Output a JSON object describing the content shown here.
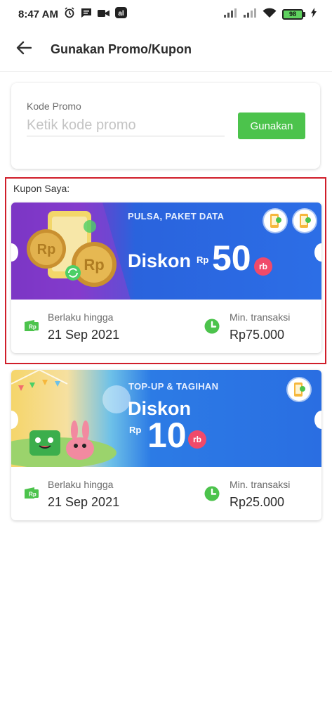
{
  "status_bar": {
    "time": "8:47 AM",
    "battery": "98"
  },
  "app_bar": {
    "title": "Gunakan Promo/Kupon"
  },
  "promo": {
    "label": "Kode Promo",
    "placeholder": "Ketik kode promo",
    "button_label": "Gunakan"
  },
  "coupons_section": {
    "label": "Kupon Saya:"
  },
  "coupons": [
    {
      "tag": "PULSA, PAKET DATA",
      "headline": "Diskon",
      "currency": "Rp",
      "amount": "50",
      "unit": "rb",
      "valid_label": "Berlaku hingga",
      "valid_date": "21 Sep 2021",
      "min_label": "Min. transaksi",
      "min_value": "Rp75.000"
    },
    {
      "tag": "TOP-UP & TAGIHAN",
      "headline": "Diskon",
      "currency": "Rp",
      "amount": "10",
      "unit": "rb",
      "valid_label": "Berlaku hingga",
      "valid_date": "21 Sep 2021",
      "min_label": "Min. transaksi",
      "min_value": "Rp25.000"
    }
  ],
  "colors": {
    "accent_green": "#4cc34c",
    "highlight_red": "#d01e2a",
    "banner_blue": "#2c6ee6",
    "banner_purple": "#7d36c8",
    "rb_pink": "#f04a6a"
  }
}
